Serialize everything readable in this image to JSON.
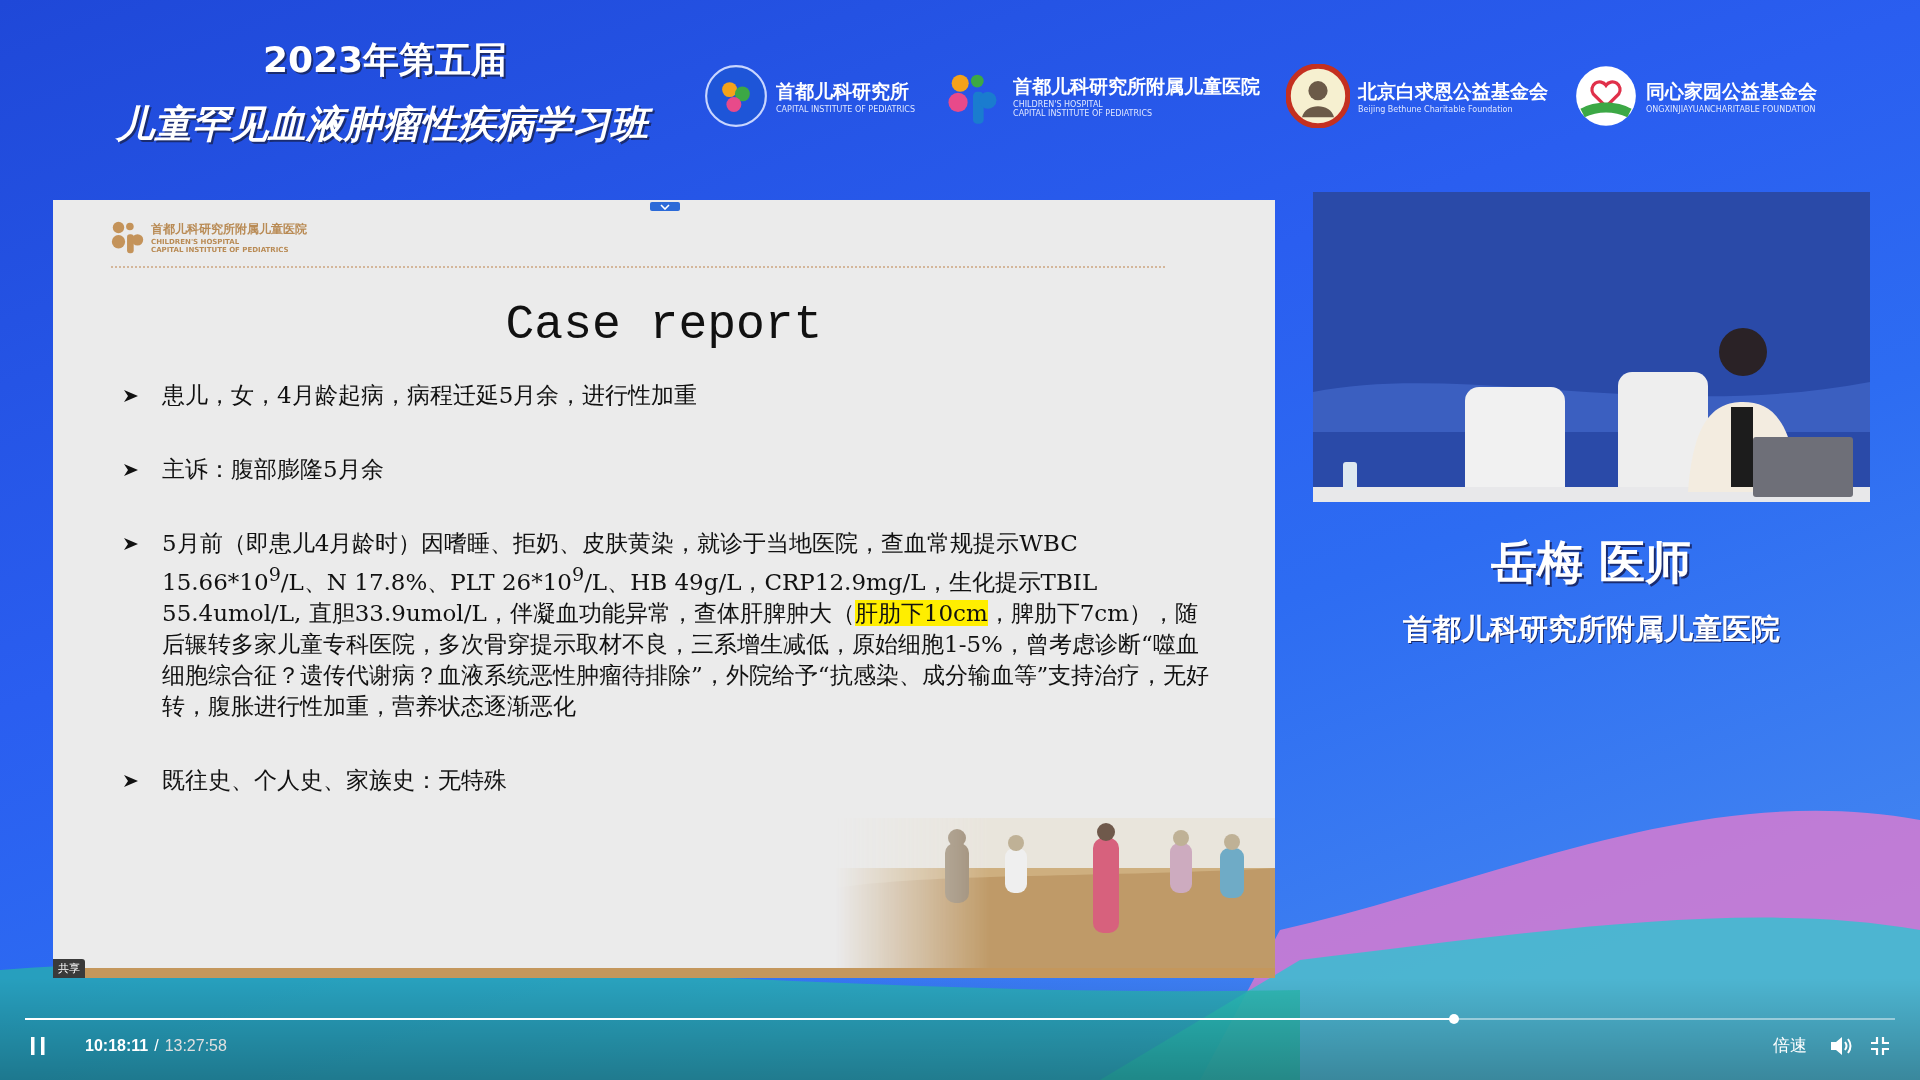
{
  "header": {
    "title_line_1": "2023年第五届",
    "title_line_2": "儿童罕见血液肿瘤性疾病学习班",
    "logos": [
      {
        "kind": "ring",
        "name": "首都儿科研究所",
        "lines": [
          "CAPITAL INSTITUTE OF PEDIATRICS"
        ]
      },
      {
        "kind": "dots",
        "name": "首都儿科研究所附属儿童医院",
        "lines": [
          "CHILDREN'S HOSPITAL",
          "CAPITAL INSTITUTE OF PEDIATRICS"
        ]
      },
      {
        "kind": "seal",
        "name": "北京白求恩公益基金会",
        "lines": [
          "Beijing Bethune Charitable Foundation"
        ]
      },
      {
        "kind": "heart",
        "name": "同心家园公益基金会",
        "lines": [
          "ONGXINJIAYUANCHARITABLE FOUNDATION"
        ]
      }
    ]
  },
  "slide": {
    "logo": {
      "name": "首都儿科研究所附属儿童医院",
      "lines": [
        "CHILDREN'S HOSPITAL",
        "CAPITAL INSTITUTE OF PEDIATRICS"
      ]
    },
    "title": "Case report",
    "bullets": [
      {
        "segments": [
          {
            "text": "患儿，女，4月龄起病，病程迁延5月余，进行性加重",
            "highlight": false
          }
        ]
      },
      {
        "segments": [
          {
            "text": "主诉：腹部膨隆5月余",
            "highlight": false
          }
        ]
      },
      {
        "segments": [
          {
            "text": "5月前（即患儿4月龄时）因嗜睡、拒奶、皮肤黄染，就诊于当地医院，查血常规提示WBC 15.66*10$^{9}$/L、N 17.8%、PLT 26*10$^{9}$/L、HB 49g/L，CRP12.9mg/L，生化提示TBIL 55.4umol/L, 直胆33.9umol/L，伴凝血功能异常，查体肝脾肿大（",
            "highlight": false
          },
          {
            "text": "肝肋下10cm",
            "highlight": true
          },
          {
            "text": "，脾肋下7cm），随后辗转多家儿童专科医院，多次骨穿提示取材不良，三系增生减低，原始细胞1-5%，曾考虑诊断“噬血细胞综合征？遗传代谢病？血液系统恶性肿瘤待排除”，外院给予“抗感染、成分输血等”支持治疗，无好转，腹胀进行性加重，营养状态逐渐恶化",
            "highlight": false
          }
        ]
      },
      {
        "segments": [
          {
            "text": " 既往史、个人史、家族史：无特殊",
            "highlight": false
          }
        ]
      }
    ],
    "share_badge": "共享"
  },
  "speaker": {
    "name": "岳梅 医师",
    "affiliation": "首都儿科研究所附属儿童医院"
  },
  "player": {
    "playing": true,
    "level": 0.764,
    "current_time": "10:18:11",
    "separator": "/",
    "total_time": "13:27:58",
    "speed": "倍速"
  }
}
